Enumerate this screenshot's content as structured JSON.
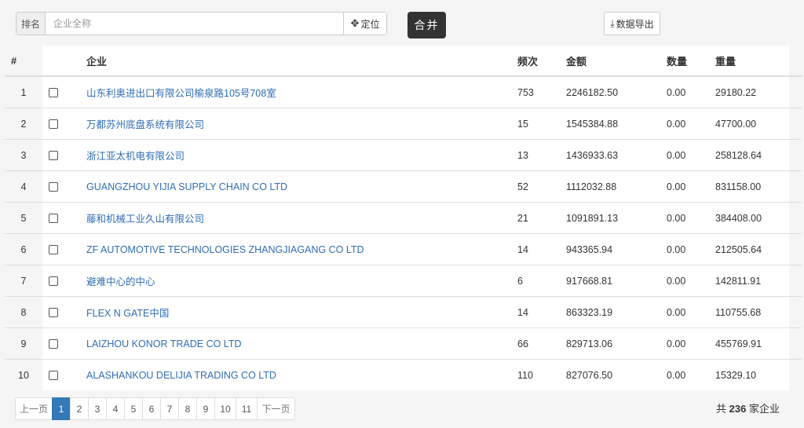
{
  "search": {
    "addon_label": "排名",
    "placeholder": "企业全称",
    "locate_icon": "crosshair-icon",
    "locate_label": "定位"
  },
  "merge_label": "合并",
  "export": {
    "icon": "download-icon",
    "label": "数据导出"
  },
  "table": {
    "headers": {
      "idx": "#",
      "name": "企业",
      "freq": "频次",
      "amount": "金额",
      "qty": "数量",
      "weight": "重量"
    },
    "rows": [
      {
        "idx": "1",
        "name": "山东利奥进出口有限公司榆泉路105号708室",
        "freq": "753",
        "amount": "2246182.50",
        "qty": "0.00",
        "weight": "29180.22"
      },
      {
        "idx": "2",
        "name": "万都苏州底盘系统有限公司",
        "freq": "15",
        "amount": "1545384.88",
        "qty": "0.00",
        "weight": "47700.00"
      },
      {
        "idx": "3",
        "name": "浙江亚太机电有限公司",
        "freq": "13",
        "amount": "1436933.63",
        "qty": "0.00",
        "weight": "258128.64"
      },
      {
        "idx": "4",
        "name": "GUANGZHOU YIJIA SUPPLY CHAIN CO LTD",
        "freq": "52",
        "amount": "1112032.88",
        "qty": "0.00",
        "weight": "831158.00"
      },
      {
        "idx": "5",
        "name": "藤和机械工业久山有限公司",
        "freq": "21",
        "amount": "1091891.13",
        "qty": "0.00",
        "weight": "384408.00"
      },
      {
        "idx": "6",
        "name": "ZF AUTOMOTIVE TECHNOLOGIES ZHANGJIAGANG CO LTD",
        "freq": "14",
        "amount": "943365.94",
        "qty": "0.00",
        "weight": "212505.64"
      },
      {
        "idx": "7",
        "name": "避难中心的中心",
        "freq": "6",
        "amount": "917668.81",
        "qty": "0.00",
        "weight": "142811.91"
      },
      {
        "idx": "8",
        "name": "FLEX N GATE中国",
        "freq": "14",
        "amount": "863323.19",
        "qty": "0.00",
        "weight": "110755.68"
      },
      {
        "idx": "9",
        "name": "LAIZHOU KONOR TRADE CO LTD",
        "freq": "66",
        "amount": "829713.06",
        "qty": "0.00",
        "weight": "455769.91"
      },
      {
        "idx": "10",
        "name": "ALASHANKOU DELIJIA TRADING CO LTD",
        "freq": "110",
        "amount": "827076.50",
        "qty": "0.00",
        "weight": "15329.10"
      }
    ]
  },
  "pagination": {
    "prev": "上一页",
    "next": "下一页",
    "pages": [
      "1",
      "2",
      "3",
      "4",
      "5",
      "6",
      "7",
      "8",
      "9",
      "10",
      "11"
    ],
    "active": "1"
  },
  "total": {
    "prefix": "共",
    "count": "236",
    "suffix": "家企业"
  }
}
